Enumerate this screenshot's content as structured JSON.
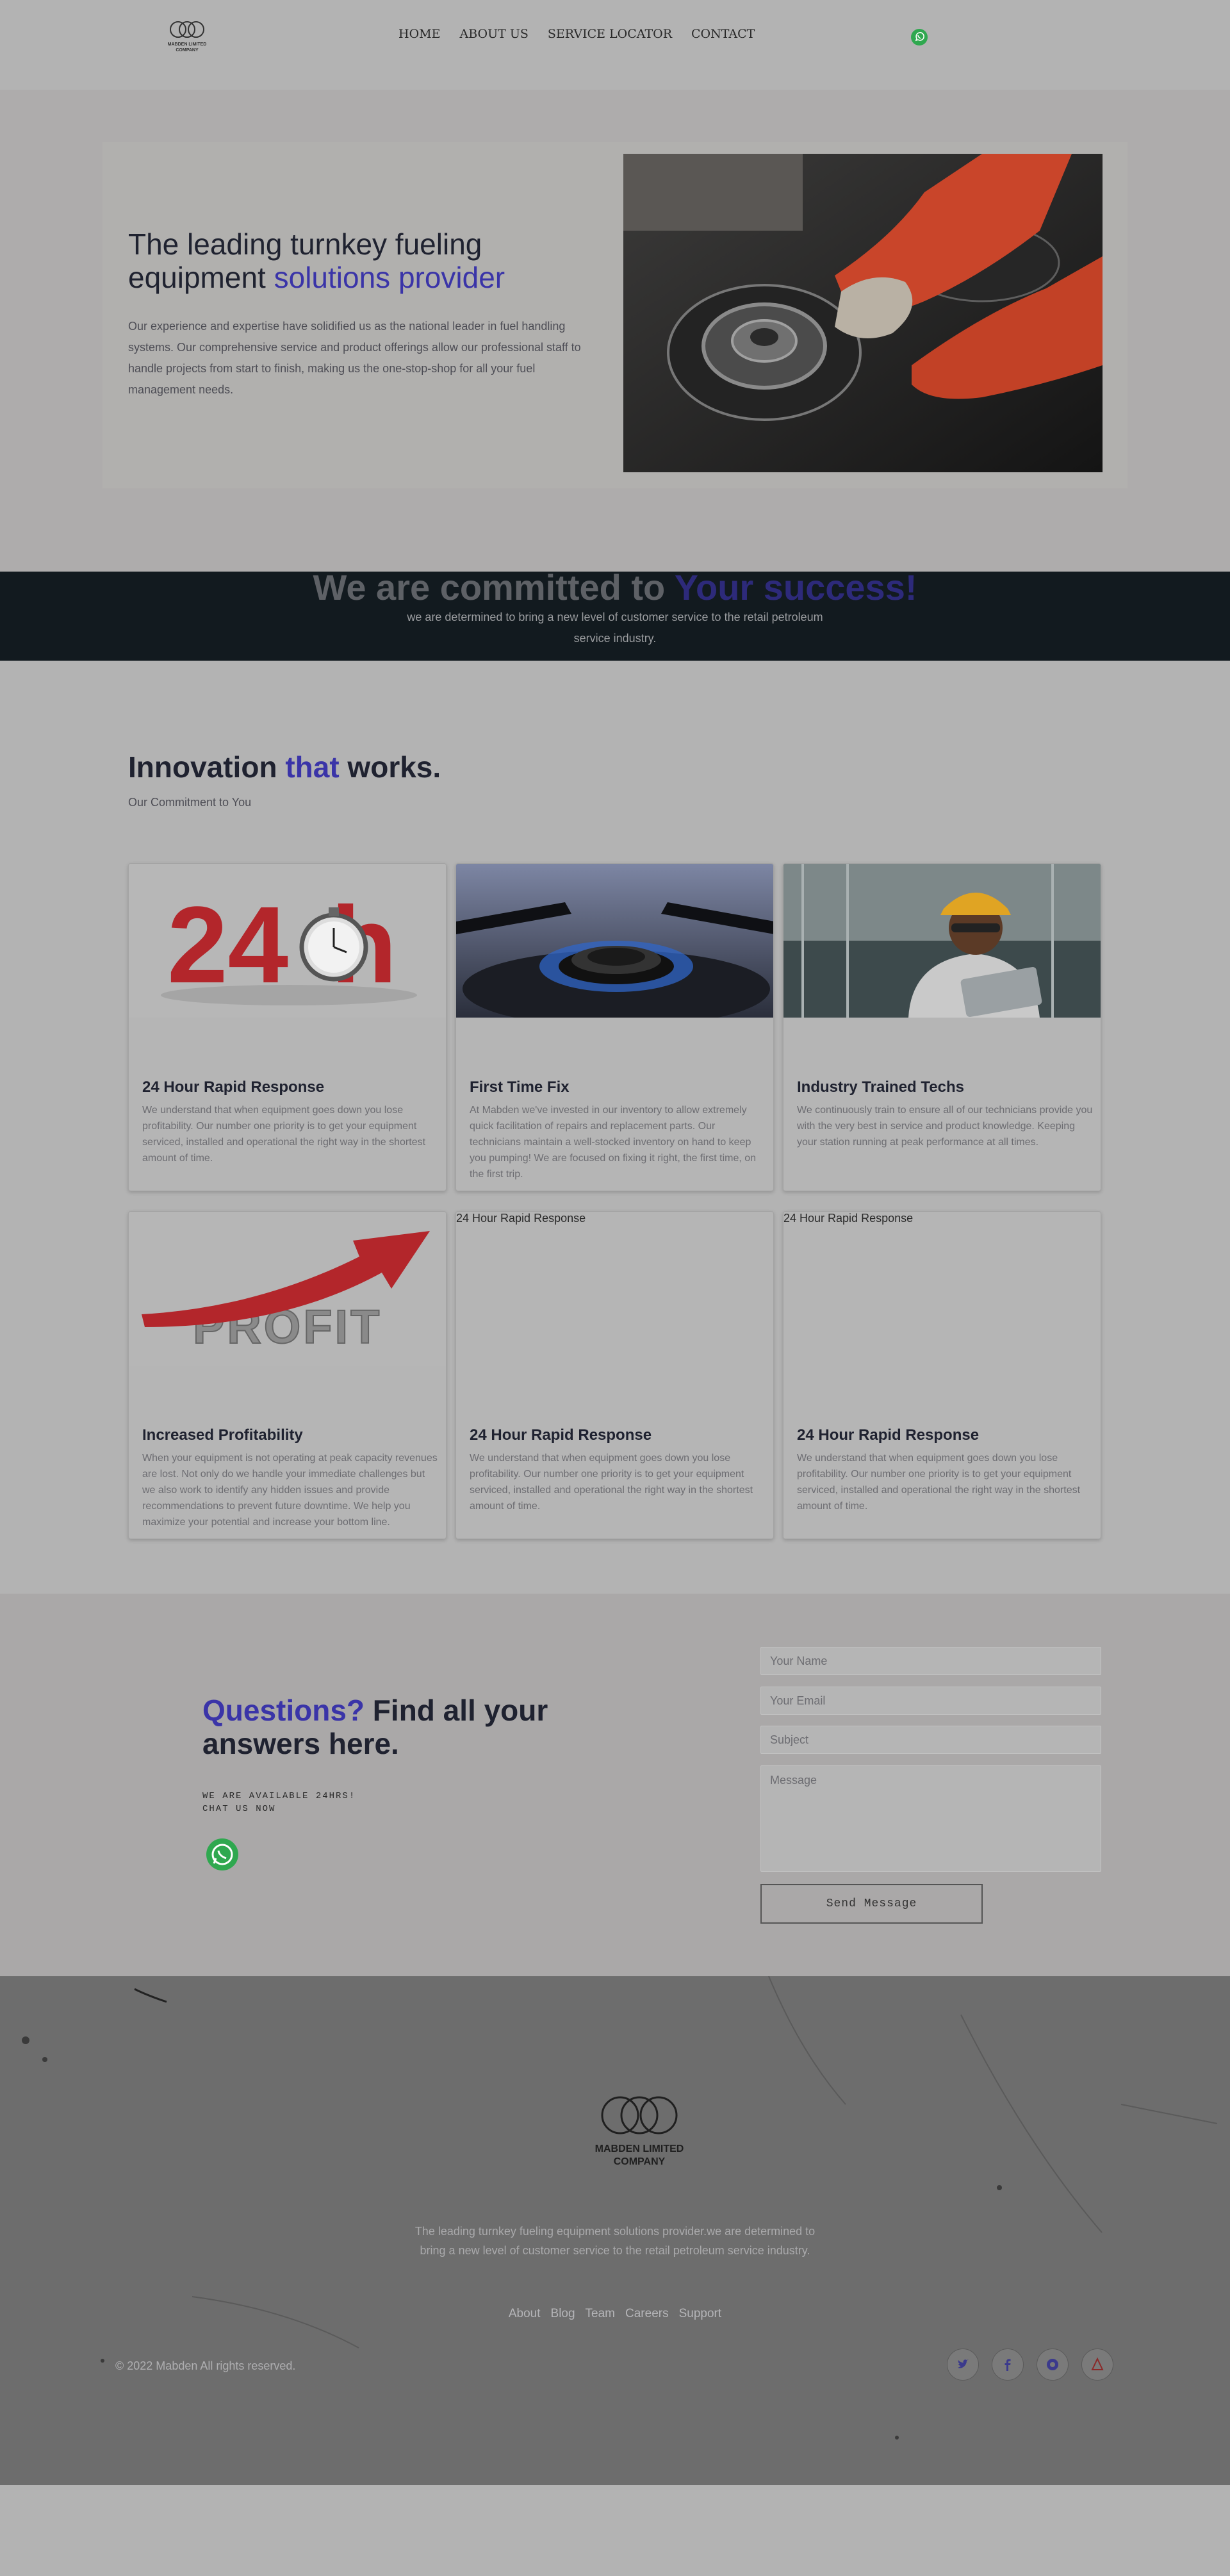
{
  "brand": {
    "logo_lines": [
      "MABDEN LIMITED",
      "COMPANY"
    ]
  },
  "nav": {
    "items": [
      {
        "label": "HOME"
      },
      {
        "label": "ABOUT US"
      },
      {
        "label": "SERVICE LOCATOR"
      },
      {
        "label": "CONTACT"
      }
    ],
    "whatsapp_icon": "whatsapp-icon"
  },
  "hero": {
    "title_line1": "The leading turnkey fueling",
    "title_line2_plain": "equipment ",
    "title_line2_accent": "solutions provider",
    "text": "Our experience and expertise have solidified us as the national leader in fuel handling systems. Our comprehensive service and product offerings allow our professional staff to handle projects from start to finish, making us the one-stop-shop for all your fuel management needs.",
    "image": "gas-stove-cleaning-photo"
  },
  "band": {
    "title_plain": "We are committed to ",
    "title_accent": "Your success!",
    "text": "we are determined to bring a new level of customer service to the retail petroleum service industry."
  },
  "innovation": {
    "title_plain1": "Innovation ",
    "title_accent": "that",
    "title_plain2": " works.",
    "subtitle": "Our Commitment to You"
  },
  "cards": [
    {
      "title": "24 Hour Rapid Response",
      "text": "We understand that when equipment goes down you lose profitability. Our number one priority is to get your equipment serviced, installed and operational the right way in the shortest amount of time.",
      "image": "24h-stopwatch-image"
    },
    {
      "title": "First Time Fix",
      "text": "At Mabden we've invested in our inventory to allow extremely quick facilitation of repairs and replacement parts. Our technicians maintain a well-stocked inventory on hand to keep you pumping! We are focused on fixing it right, the first time, on the first trip.",
      "image": "gas-burner-flame-image"
    },
    {
      "title": "Industry Trained Techs",
      "text": "We continuously train to ensure all of our technicians provide you with the very best in service and product knowledge. Keeping your station running at peak performance at all times.",
      "image": "technician-tablet-image"
    },
    {
      "title": "Increased Profitability",
      "text": "When your equipment is not operating at peak capacity revenues are lost. Not only do we handle your immediate challenges but we also work to identify any hidden issues and provide recommendations to prevent future downtime. We help you maximize your potential and increase your bottom line.",
      "image": "profit-arrow-image"
    },
    {
      "title": "24 Hour Rapid Response",
      "text": "We understand that when equipment goes down you lose profitability. Our number one priority is to get your equipment serviced, installed and operational the right way in the shortest amount of time.",
      "image_alt": "24 Hour Rapid Response"
    },
    {
      "title": "24 Hour Rapid Response",
      "text": "We understand that when equipment goes down you lose profitability. Our number one priority is to get your equipment serviced, installed and operational the right way in the shortest amount of time.",
      "image_alt": "24 Hour Rapid Response"
    }
  ],
  "contact": {
    "title_accent": "Questions?",
    "title_plain": " Find all your answers here.",
    "available_line1": "WE ARE AVAILABLE 24HRS!",
    "available_line2": "CHAT US NOW",
    "name_placeholder": "Your Name",
    "email_placeholder": "Your Email",
    "subject_placeholder": "Subject",
    "message_placeholder": "Message",
    "send_label": "Send Message"
  },
  "footer": {
    "logo_lines": [
      "MABDEN LIMITED",
      "COMPANY"
    ],
    "text": "The leading turnkey fueling equipment solutions provider.we are determined to bring a new level of customer service to the retail petroleum service industry.",
    "links": [
      {
        "label": "About"
      },
      {
        "label": "Blog"
      },
      {
        "label": "Team"
      },
      {
        "label": "Careers"
      },
      {
        "label": "Support"
      }
    ],
    "copyright": "© 2022 Mabden All rights reserved.",
    "socials": [
      "twitter-icon",
      "facebook-icon",
      "instagram-icon",
      "google-plus-icon"
    ]
  },
  "colors": {
    "accent": "#3a34a8",
    "dark_band": "#121a1f",
    "whatsapp": "#25d366"
  }
}
